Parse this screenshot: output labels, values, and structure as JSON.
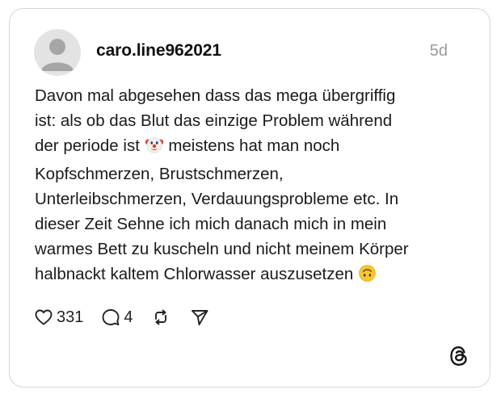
{
  "post": {
    "username": "caro.line962021",
    "timestamp": "5d",
    "text_lines": [
      "Davon mal abgesehen dass das mega übergriffig",
      "ist: als ob das Blut das einzige Problem während",
      "der periode ist",
      "meistens hat man noch",
      "Kopfschmerzen, Brustschmerzen,",
      "Unterleibschmerzen, Verdauungsprobleme etc. In",
      "dieser Zeit Sehne ich mich danach mich in mein",
      "warmes Bett zu kuscheln und nicht meinem Körper",
      "halbnackt kaltem Chlorwasser auszusetzen"
    ],
    "emojis": [
      "clown-face-emoji",
      "upside-down-face-emoji"
    ]
  },
  "actions": {
    "likes": "331",
    "comments": "4"
  },
  "icons": [
    "avatar-placeholder-icon",
    "heart-icon",
    "comment-icon",
    "repost-icon",
    "share-icon",
    "threads-logo-icon"
  ],
  "colors": {
    "border": "#d6d6d6",
    "text": "#1a1a1a",
    "timestamp": "#9a9a9a",
    "avatar_bg": "#e3e3e3",
    "avatar_figure": "#a6a6a6"
  }
}
